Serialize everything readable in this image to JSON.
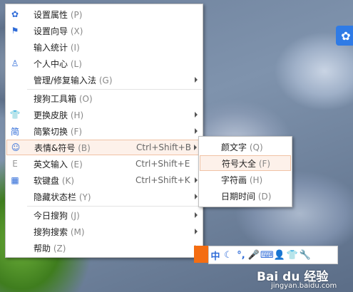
{
  "menu": {
    "items": [
      {
        "icon": "gear-icon",
        "glyph": "✿",
        "label": "设置属性",
        "key": "(P)"
      },
      {
        "icon": "flag-icon",
        "glyph": "⚑",
        "label": "设置向导",
        "key": "(X)"
      },
      {
        "icon": "",
        "glyph": "",
        "label": "输入统计",
        "key": "(I)"
      },
      {
        "icon": "person-icon",
        "glyph": "♙",
        "label": "个人中心",
        "key": "(L)"
      },
      {
        "icon": "",
        "glyph": "",
        "label": "管理/修复输入法",
        "key": "(G)",
        "arrow": true
      },
      {
        "icon": "",
        "glyph": "",
        "label": "搜狗工具箱",
        "key": "(O)"
      },
      {
        "icon": "shirt-icon",
        "glyph": "👕",
        "label": "更换皮肤",
        "key": "(H)",
        "arrow": true
      },
      {
        "icon": "simplified-traditional-icon",
        "glyph": "简",
        "label": "简繁切换",
        "key": "(F)",
        "arrow": true
      },
      {
        "icon": "smiley-icon",
        "glyph": "☺",
        "label": "表情&符号",
        "key": "(B)",
        "shortcut": "Ctrl+Shift+B",
        "arrow": true
      },
      {
        "icon": "english-icon",
        "glyph": "E",
        "label": "英文输入",
        "key": "(E)",
        "shortcut": "Ctrl+Shift+E"
      },
      {
        "icon": "keyboard-icon",
        "glyph": "▦",
        "label": "软键盘",
        "key": "(K)",
        "shortcut": "Ctrl+Shift+K",
        "arrow": true
      },
      {
        "icon": "",
        "glyph": "",
        "label": "隐藏状态栏",
        "key": "(Y)",
        "arrow": true
      },
      {
        "icon": "",
        "glyph": "",
        "label": "今日搜狗",
        "key": "(J)",
        "arrow": true
      },
      {
        "icon": "",
        "glyph": "",
        "label": "搜狗搜索",
        "key": "(M)",
        "arrow": true
      },
      {
        "icon": "",
        "glyph": "",
        "label": "帮助",
        "key": "(Z)",
        "arrow": true
      }
    ]
  },
  "submenu": {
    "items": [
      {
        "label": "颜文字",
        "key": "(Q)"
      },
      {
        "label": "符号大全",
        "key": "(F)"
      },
      {
        "label": "字符画",
        "key": "(H)"
      },
      {
        "label": "日期时间",
        "key": "(D)"
      }
    ]
  },
  "tray": {
    "glyphs": [
      "中",
      "☾",
      "°,",
      "🎤",
      "⌨",
      "👤",
      "👕",
      "🔧"
    ]
  },
  "side_button": {
    "glyph": "✿"
  },
  "watermark": {
    "main": "Bai du 经验",
    "sub": "jingyan.baidu.com"
  }
}
